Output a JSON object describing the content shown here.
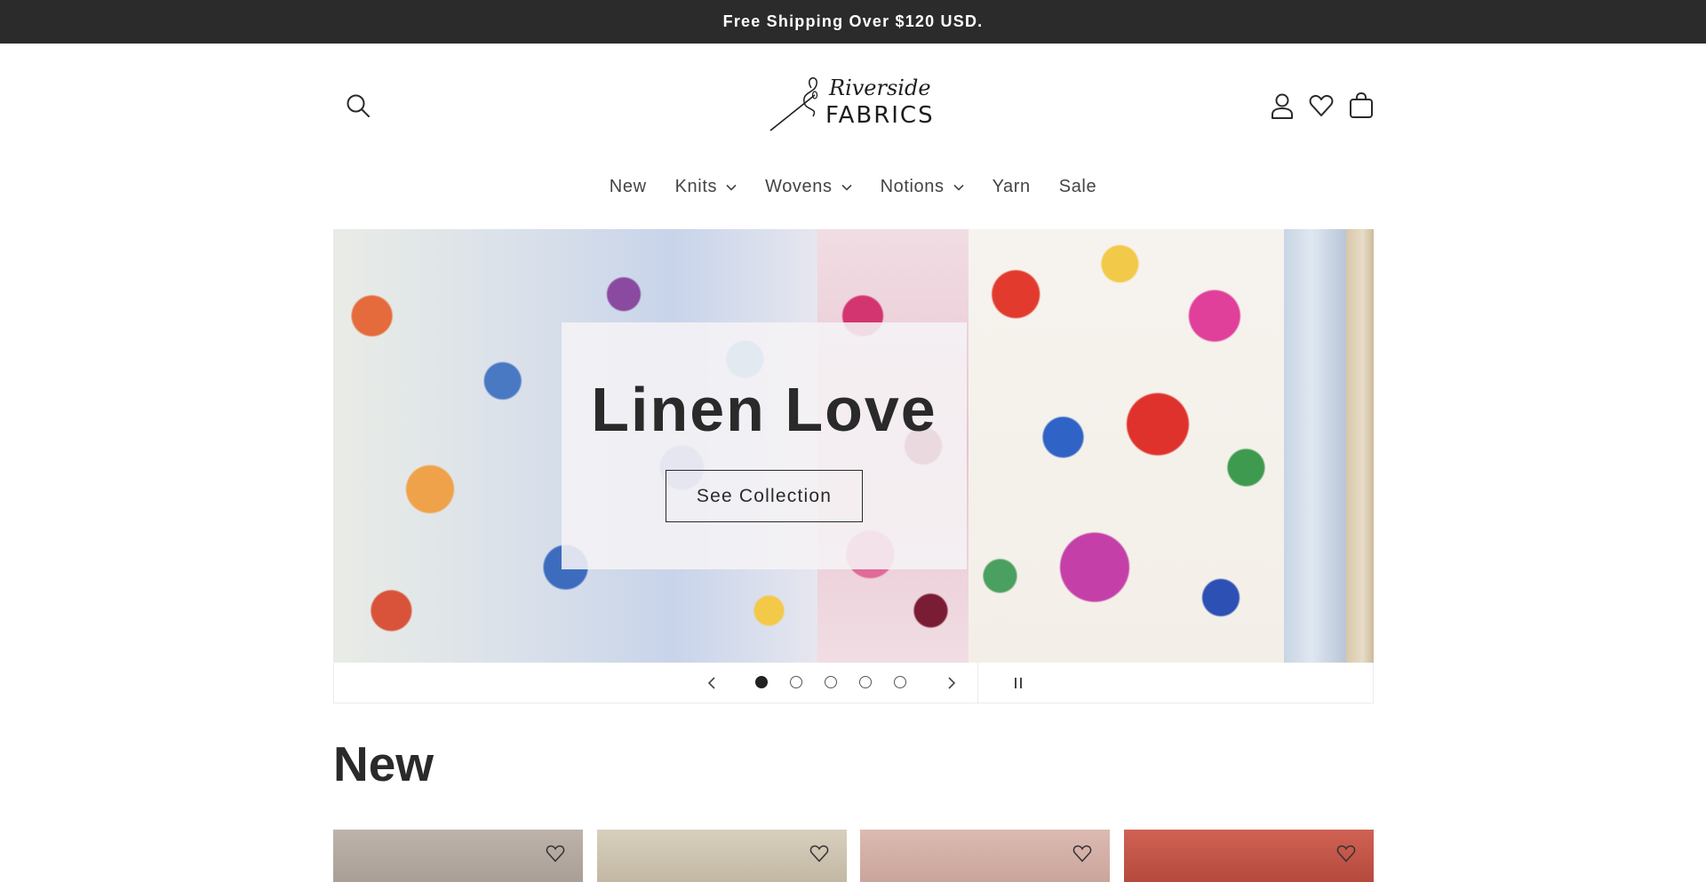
{
  "announcement": {
    "text": "Free Shipping Over $120 USD."
  },
  "brand": {
    "script": "Riverside",
    "main": "FABRICS"
  },
  "header_icons": {
    "search": "search-icon",
    "account": "user-icon",
    "wishlist": "heart-icon",
    "cart": "cart-icon"
  },
  "nav": {
    "items": [
      {
        "label": "New",
        "has_dropdown": false
      },
      {
        "label": "Knits",
        "has_dropdown": true
      },
      {
        "label": "Wovens",
        "has_dropdown": true
      },
      {
        "label": "Notions",
        "has_dropdown": true
      },
      {
        "label": "Yarn",
        "has_dropdown": false
      },
      {
        "label": "Sale",
        "has_dropdown": false
      }
    ]
  },
  "hero": {
    "title": "Linen Love",
    "cta_label": "See Collection",
    "slide_count": 5,
    "active_slide": 1
  },
  "section": {
    "title": "New"
  },
  "colors": {
    "announcement_bg": "#2b2b2b",
    "text": "#2a2a2a",
    "product_1": "#bdb3aa",
    "product_2": "#cfc6b4",
    "product_3": "#d8b4ab",
    "product_4": "#c9594b"
  }
}
